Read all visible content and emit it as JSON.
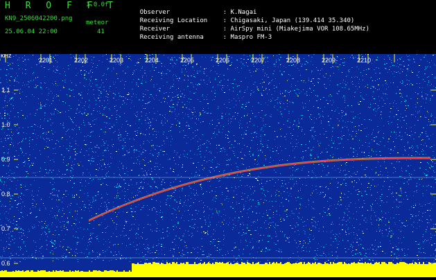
{
  "header": {
    "app_title": "H R O F F T",
    "version": "1.0.0f",
    "filename": "KN9_2506042200.png",
    "mode_label": "meteor",
    "datetime": "25.06.04 22:00",
    "count": "41"
  },
  "meta": [
    {
      "key": "Observer",
      "value": ": K.Nagai"
    },
    {
      "key": "Receiving Location",
      "value": ": Chigasaki, Japan (139.414 35.340)"
    },
    {
      "key": "Receiver",
      "value": ": AirSpy mini (Miakejima VOR 108.65MHz)"
    },
    {
      "key": "Receiving antenna",
      "value": ": Maspro FM-3"
    }
  ],
  "plot": {
    "y_unit": "kHz",
    "y_ticks": [
      "1.1",
      "1.0",
      "0.9",
      "0.8",
      "0.7",
      "0.6"
    ],
    "time_ticks": [
      "2201",
      "2202",
      "2203",
      "2204",
      "2205",
      "2206",
      "2207",
      "2208",
      "2209",
      "2210"
    ],
    "colors": {
      "background": "#0a2a9a",
      "noise_cyan": "#1fd0e8",
      "noise_white": "#e8ffff",
      "trace": "#ff3030",
      "trace_glow": "#ffe040",
      "baseline": "#ffff00",
      "tick": "#ffff00"
    }
  }
}
